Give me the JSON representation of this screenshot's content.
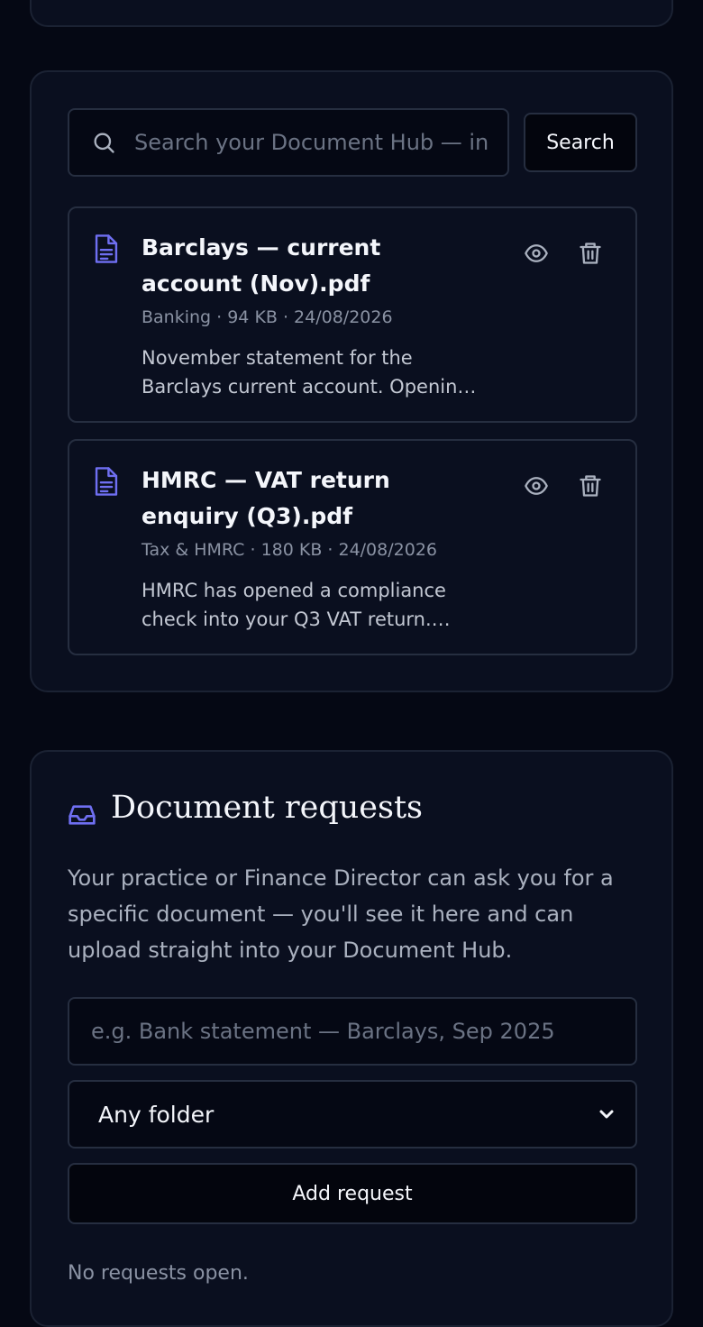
{
  "search": {
    "placeholder": "Search your Document Hub — in titles and contents",
    "button_label": "Search"
  },
  "documents": [
    {
      "title": "Barclays — current account (Nov).pdf",
      "meta": "Banking · 94 KB · 24/08/2026",
      "description": "November statement for the Barclays current account. Opening balance and transactions for the month."
    },
    {
      "title": "HMRC — VAT return enquiry (Q3).pdf",
      "meta": "Tax & HMRC · 180 KB · 24/08/2026",
      "description": "HMRC has opened a compliance check into your Q3 VAT return. Please provide supporting records."
    }
  ],
  "requests": {
    "title": "Document requests",
    "description": "Your practice or Finance Director can ask you for a specific document — you'll see it here and can upload straight into your Document Hub.",
    "input_placeholder": "e.g. Bank statement — Barclays, Sep 2025",
    "folder_selected": "Any folder",
    "add_label": "Add request",
    "empty_text": "No requests open."
  },
  "colors": {
    "accent": "#6f6ff2",
    "background": "#050814",
    "card": "#0a0f1f",
    "border": "#262e40"
  }
}
